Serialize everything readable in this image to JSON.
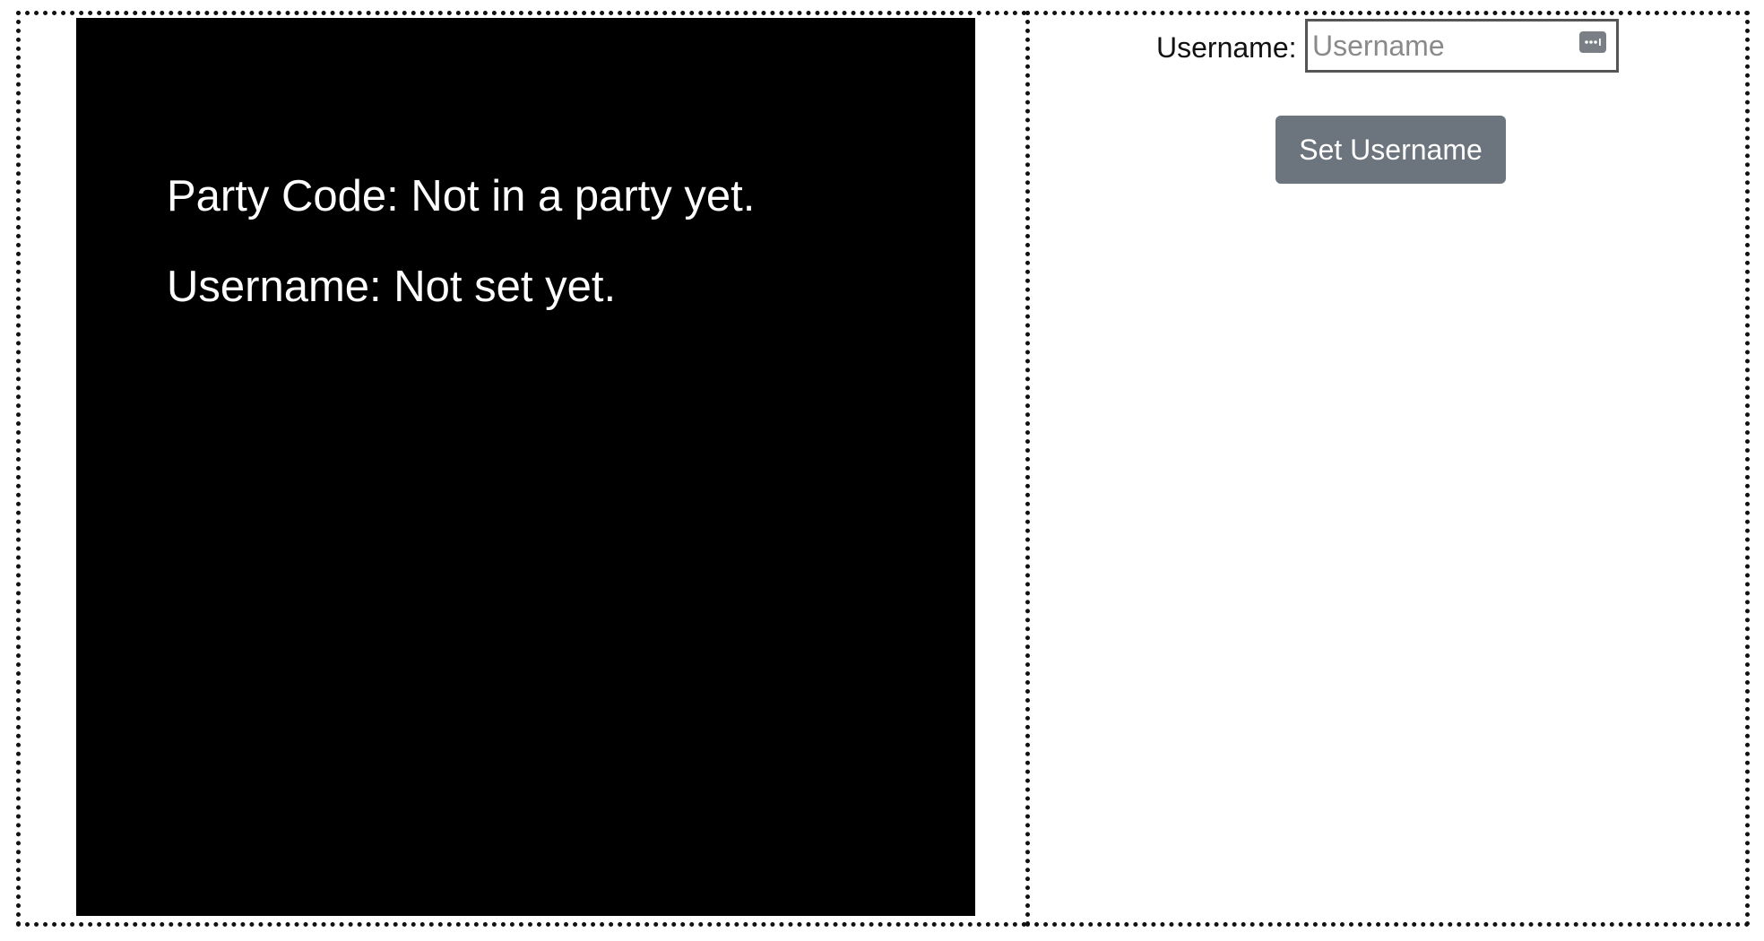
{
  "game": {
    "party_code_text": "Party Code: Not in a party yet.",
    "username_text": "Username: Not set yet."
  },
  "form": {
    "label": "Username:",
    "input_placeholder": "Username",
    "input_value": "",
    "icon": "password-manager-icon",
    "button_label": "Set Username"
  },
  "colors": {
    "canvas": "#000000",
    "button": "#6c757d",
    "text_light": "#ffffff"
  }
}
